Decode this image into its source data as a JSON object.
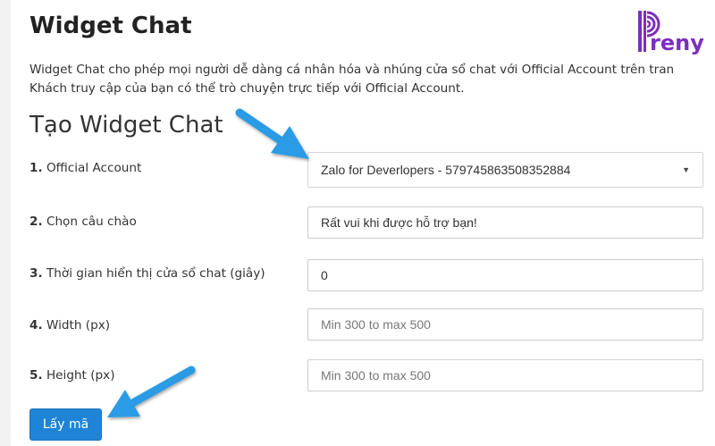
{
  "page": {
    "title": "Widget Chat",
    "intro_line1": "Widget Chat cho phép mọi người dễ dàng cá nhân hóa và nhúng cửa sổ chat với Official Account trên tran",
    "intro_line2": "Khách truy cập của bạn có thể trò chuyện trực tiếp với Official Account."
  },
  "logo": {
    "text": "reny",
    "color": "#7b2fbe"
  },
  "form": {
    "title": "Tạo Widget Chat",
    "fields": [
      {
        "number": "1.",
        "label": "Official Account",
        "value": "Zalo for Deverlopers - 579745863508352884",
        "placeholder": ""
      },
      {
        "number": "2.",
        "label": "Chọn câu chào",
        "value": "Rất vui khi được hỗ trợ bạn!",
        "placeholder": ""
      },
      {
        "number": "3.",
        "label": "Thời gian hiển thị cửa sổ chat (giây)",
        "value": "0",
        "placeholder": ""
      },
      {
        "number": "4.",
        "label": "Width (px)",
        "value": "",
        "placeholder": "Min 300 to max 500"
      },
      {
        "number": "5.",
        "label": "Height (px)",
        "value": "",
        "placeholder": "Min 300 to max 500"
      }
    ],
    "submit_label": "Lấy mã"
  },
  "colors": {
    "accent": "#1f84d6",
    "arrow": "#2b9be4"
  }
}
